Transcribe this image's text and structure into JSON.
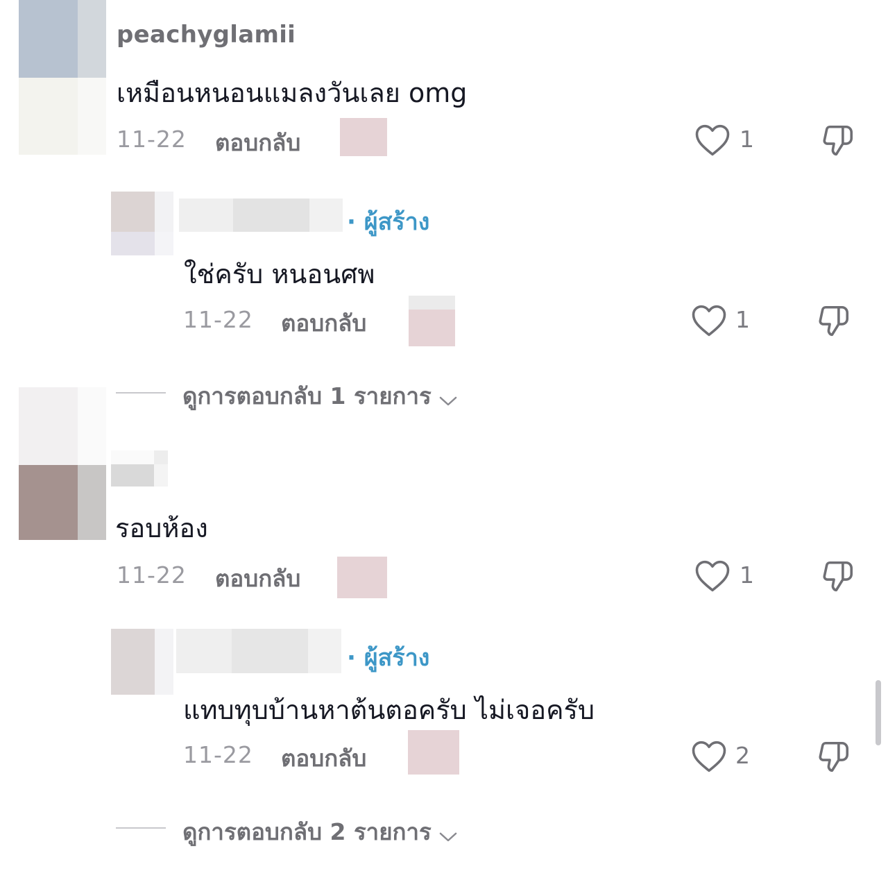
{
  "comments": [
    {
      "username": "peachyglamii",
      "text": "เหมือนหนอนแมลงวันเลย omg",
      "date": "11-22",
      "reply_label": "ตอบกลับ",
      "likes": "1",
      "reply": {
        "creator_badge": "· ผู้สร้าง",
        "text": "ใช่ครับ หนอนศพ",
        "date": "11-22",
        "reply_label": "ตอบกลับ",
        "likes": "1"
      },
      "view_more": "ดูการตอบกลับ 1 รายการ"
    },
    {
      "username": "",
      "text": "รอบห้อง",
      "date": "11-22",
      "reply_label": "ตอบกลับ",
      "likes": "1",
      "reply": {
        "creator_badge": "· ผู้สร้าง",
        "text": "แทบทุบบ้านหาต้นตอครับ ไม่เจอครับ",
        "date": "11-22",
        "reply_label": "ตอบกลับ",
        "likes": "2"
      },
      "view_more": "ดูการตอบกลับ 2 รายการ"
    }
  ],
  "icons": {
    "like": "heart-outline-icon",
    "dislike": "thumbs-down-icon",
    "expand": "chevron-down-icon"
  },
  "colors": {
    "creator_badge": "#3d97c7",
    "muted_text": "#9a9aa0",
    "main_text": "#161823"
  }
}
